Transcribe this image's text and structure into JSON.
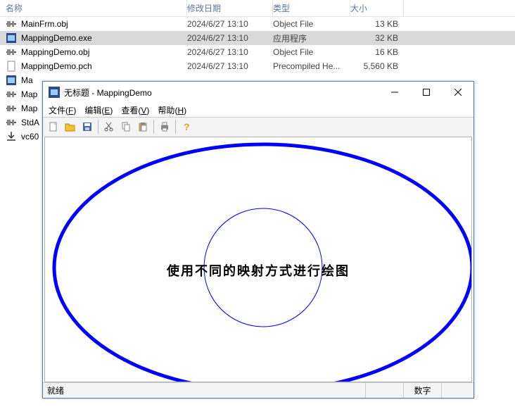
{
  "explorer": {
    "columns": {
      "name": "名称",
      "date": "修改日期",
      "type": "类型",
      "size": "大小"
    },
    "rows": [
      {
        "name": "MainFrm.obj",
        "date": "2024/6/27 13:10",
        "type": "Object File",
        "size": "13 KB",
        "selected": false,
        "icon": "obj"
      },
      {
        "name": "MappingDemo.exe",
        "date": "2024/6/27 13:10",
        "type": "应用程序",
        "size": "32 KB",
        "selected": true,
        "icon": "exe"
      },
      {
        "name": "MappingDemo.obj",
        "date": "2024/6/27 13:10",
        "type": "Object File",
        "size": "16 KB",
        "selected": false,
        "icon": "obj"
      },
      {
        "name": "MappingDemo.pch",
        "date": "2024/6/27 13:10",
        "type": "Precompiled He...",
        "size": "5,560 KB",
        "selected": false,
        "icon": "generic"
      }
    ],
    "partial_rows": [
      {
        "name": "Ma"
      },
      {
        "name": "Map"
      },
      {
        "name": "Map"
      },
      {
        "name": "StdA"
      },
      {
        "name": "vc60"
      }
    ]
  },
  "app": {
    "title": "无标题 - MappingDemo",
    "menu": {
      "file": {
        "label": "文件",
        "accel": "F"
      },
      "edit": {
        "label": "编辑",
        "accel": "E"
      },
      "view": {
        "label": "查看",
        "accel": "V"
      },
      "help": {
        "label": "帮助",
        "accel": "H"
      }
    },
    "toolbar_icons": {
      "new": "new-file-icon",
      "open": "open-folder-icon",
      "save": "save-disk-icon",
      "cut": "cut-icon",
      "copy": "copy-icon",
      "paste": "paste-icon",
      "print": "print-icon",
      "help": "help-icon"
    },
    "client_text": "使用不同的映射方式进行绘图",
    "status": {
      "ready": "就绪",
      "num": "数字"
    },
    "colors": {
      "thick_ellipse": "#0000FF",
      "thin_ellipse": "#0000FF"
    }
  }
}
